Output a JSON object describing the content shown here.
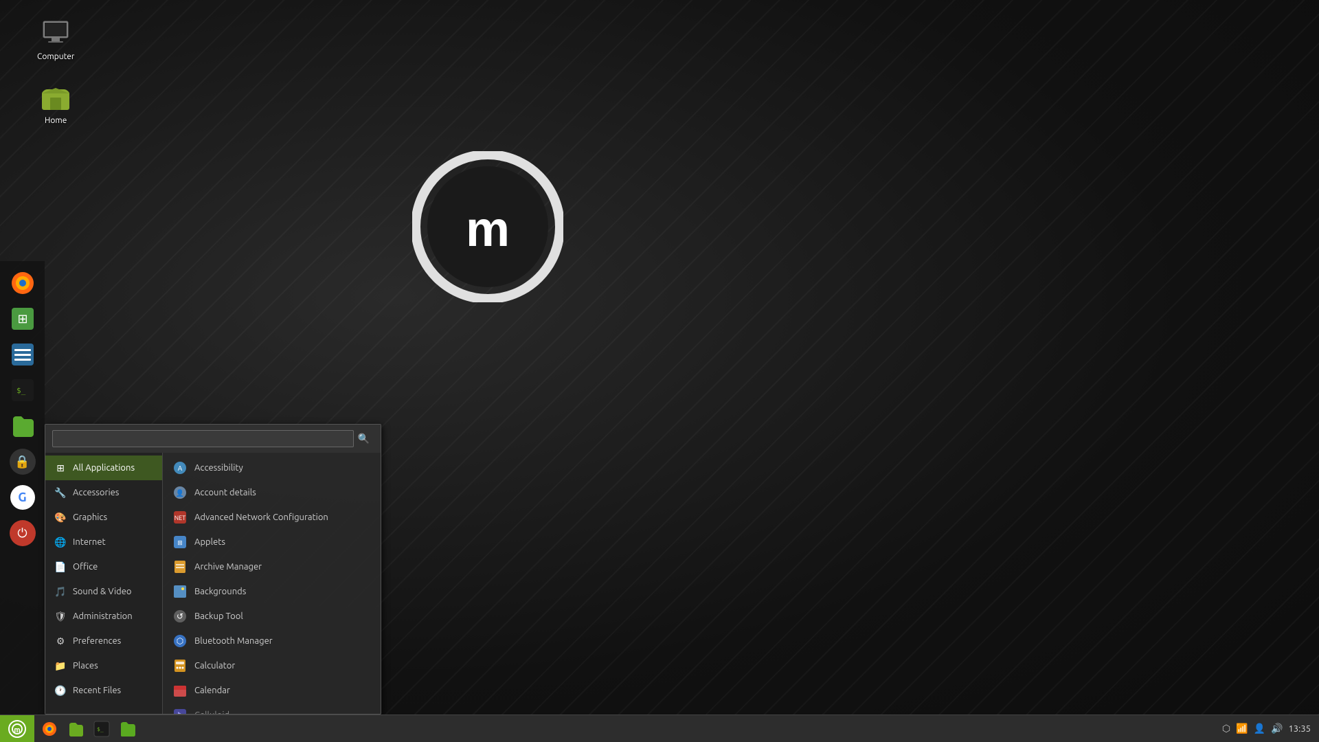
{
  "desktop": {
    "background_color": "#1a1a1a"
  },
  "desktop_icons": [
    {
      "id": "computer",
      "label": "Computer",
      "icon": "monitor"
    },
    {
      "id": "home",
      "label": "Home",
      "icon": "folder-home"
    }
  ],
  "taskbar": {
    "start_icon": "mint-logo",
    "time": "13:35",
    "apps": [
      {
        "id": "firefox",
        "icon": "firefox"
      },
      {
        "id": "files",
        "icon": "files"
      },
      {
        "id": "terminal",
        "icon": "terminal"
      },
      {
        "id": "folder",
        "icon": "folder"
      }
    ],
    "system_icons": [
      "bluetooth",
      "network",
      "user",
      "volume",
      "time"
    ]
  },
  "dock": {
    "items": [
      {
        "id": "firefox",
        "icon": "🦊",
        "color": "#e55"
      },
      {
        "id": "software",
        "icon": "⊞",
        "color": "#4a9"
      },
      {
        "id": "manager",
        "icon": "≡",
        "color": "#4aaa"
      },
      {
        "id": "terminal",
        "icon": "$_",
        "color": "#333"
      },
      {
        "id": "folder",
        "icon": "📁",
        "color": "#8ab"
      },
      {
        "id": "lock",
        "icon": "🔒",
        "color": "#555"
      },
      {
        "id": "google",
        "icon": "G",
        "color": "#fff"
      },
      {
        "id": "power",
        "icon": "⏻",
        "color": "#c0392b"
      }
    ]
  },
  "app_menu": {
    "search_placeholder": "",
    "categories": [
      {
        "id": "all",
        "label": "All Applications",
        "icon": "⊞",
        "active": true
      },
      {
        "id": "accessories",
        "label": "Accessories",
        "icon": "🔧"
      },
      {
        "id": "graphics",
        "label": "Graphics",
        "icon": "🎨"
      },
      {
        "id": "internet",
        "label": "Internet",
        "icon": "🌐"
      },
      {
        "id": "office",
        "label": "Office",
        "icon": "📄"
      },
      {
        "id": "sound-video",
        "label": "Sound & Video",
        "icon": "🎵"
      },
      {
        "id": "administration",
        "label": "Administration",
        "icon": "🛡"
      },
      {
        "id": "preferences",
        "label": "Preferences",
        "icon": "⚙"
      },
      {
        "id": "places",
        "label": "Places",
        "icon": "📁"
      },
      {
        "id": "recent",
        "label": "Recent Files",
        "icon": "🕐"
      }
    ],
    "apps": [
      {
        "id": "accessibility",
        "label": "Accessibility",
        "icon": "♿",
        "color": "#4aa3e0"
      },
      {
        "id": "account",
        "label": "Account details",
        "icon": "👤",
        "color": "#7a9fc4"
      },
      {
        "id": "network",
        "label": "Advanced Network Configuration",
        "icon": "🔌",
        "color": "#e05555"
      },
      {
        "id": "applets",
        "label": "Applets",
        "icon": "◼",
        "color": "#4a90d9"
      },
      {
        "id": "archive",
        "label": "Archive Manager",
        "icon": "📦",
        "color": "#f0a830"
      },
      {
        "id": "backgrounds",
        "label": "Backgrounds",
        "icon": "🖼",
        "color": "#5b9bd5"
      },
      {
        "id": "backup",
        "label": "Backup Tool",
        "icon": "⏮",
        "color": "#999"
      },
      {
        "id": "bluetooth",
        "label": "Bluetooth Manager",
        "icon": "⬡",
        "color": "#3a7bd5"
      },
      {
        "id": "calculator",
        "label": "Calculator",
        "icon": "🧮",
        "color": "#e8a020"
      },
      {
        "id": "calendar",
        "label": "Calendar",
        "icon": "📅",
        "color": "#e05050"
      },
      {
        "id": "celluloid",
        "label": "Celluloid",
        "icon": "▶",
        "color": "#7a7aff"
      }
    ]
  }
}
